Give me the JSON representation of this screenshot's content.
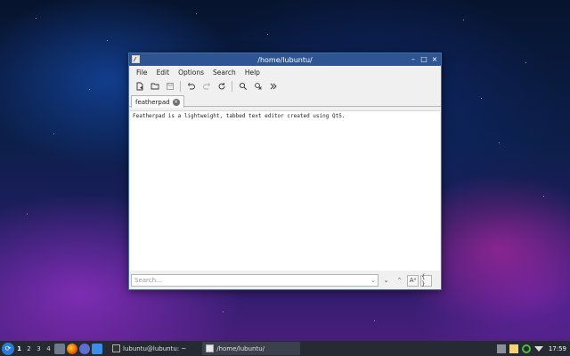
{
  "window": {
    "title": "/home/lubuntu/",
    "controls": {
      "minimize": "–",
      "maximize": "□",
      "close": "×"
    }
  },
  "menu": {
    "items": [
      "File",
      "Edit",
      "Options",
      "Search",
      "Help"
    ]
  },
  "toolbar": {
    "buttons": [
      "new-document-icon",
      "open-folder-icon",
      "save-icon",
      "undo-icon",
      "redo-icon",
      "reload-icon",
      "find-icon",
      "replace-icon",
      "more-icon"
    ]
  },
  "tab": {
    "label": "featherpad",
    "close_icon": "×"
  },
  "editor": {
    "content": "Featherpad is a lightweight, tabbed text editor created using Qt5."
  },
  "search": {
    "placeholder": "Search...",
    "dropdown_icon": "⌄",
    "buttons": {
      "down": "⌄",
      "up": "⌃",
      "match_case": "Aᵃ",
      "whole_word": "{ }"
    }
  },
  "taskbar": {
    "start_icon": "start-menu-icon",
    "desktops": [
      "1",
      "2",
      "3",
      "4"
    ],
    "tasks": [
      {
        "label": "lubuntu@lubuntu: ~"
      },
      {
        "label": "/home/lubuntu/"
      }
    ],
    "clock": "17:59"
  },
  "colors": {
    "titlebar": "#2e5591",
    "taskbar": "#262a33",
    "accent": "#2d7bd6"
  }
}
